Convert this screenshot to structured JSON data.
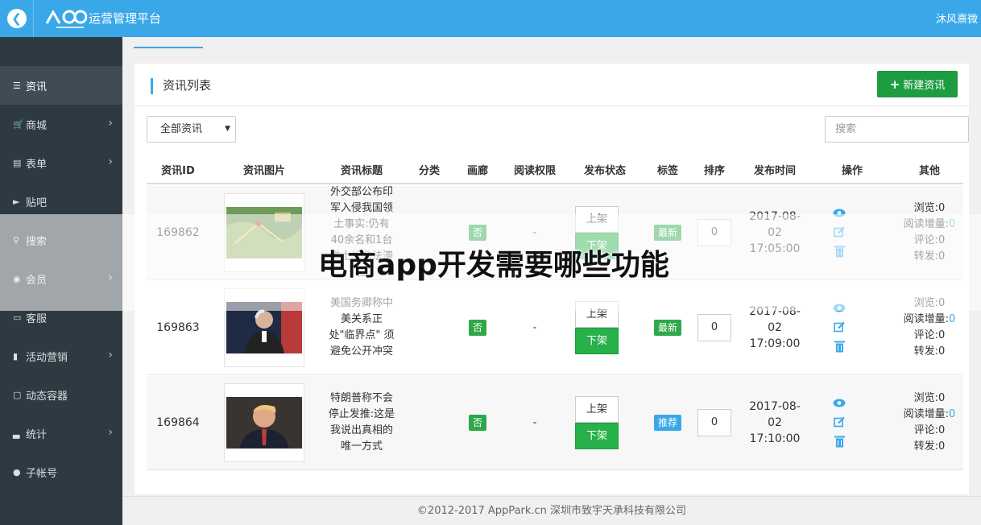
{
  "header": {
    "title": "运营管理平台",
    "user": "沐风熹微"
  },
  "sidebar": {
    "items": [
      {
        "label": "资讯",
        "icon": "list-icon"
      },
      {
        "label": "商城",
        "icon": "cart-icon"
      },
      {
        "label": "表单",
        "icon": "form-icon"
      },
      {
        "label": "贴吧",
        "icon": "megaphone-icon"
      },
      {
        "label": "搜索",
        "icon": "search-icon"
      },
      {
        "label": "会员",
        "icon": "bell-icon"
      },
      {
        "label": "客服",
        "icon": "chat-icon"
      },
      {
        "label": "活动营销",
        "icon": "bookmark-icon"
      },
      {
        "label": "动态容器",
        "icon": "container-icon"
      },
      {
        "label": "统计",
        "icon": "bar-chart-icon"
      },
      {
        "label": "子帐号",
        "icon": "user-icon"
      }
    ]
  },
  "panel": {
    "title": "资讯列表",
    "new_button": "新建资讯",
    "filter_value": "全部资讯",
    "search_placeholder": "搜索"
  },
  "table": {
    "columns": [
      "资讯ID",
      "资讯图片",
      "资讯标题",
      "分类",
      "画廊",
      "阅读权限",
      "发布状态",
      "标签",
      "排序",
      "发布时间",
      "操作",
      "其他"
    ],
    "rows": [
      {
        "id": "169862",
        "title_lines": [
          "外交部公布印",
          "军入侵我国领",
          "土事实:仍有",
          "40余名和1台",
          "推土机非法滞",
          "留"
        ],
        "gallery": "否",
        "permission": "-",
        "publish_up": "上架",
        "publish_down": "下架",
        "tag": "最新",
        "sort": "0",
        "time_lines": [
          "2017-08-",
          "02",
          "17:05:00"
        ],
        "stats": {
          "browse": "浏览:0",
          "read_inc_label": "阅读增量:",
          "read_inc_value": "0",
          "comment": "评论:0",
          "share": "转发:0"
        }
      },
      {
        "id": "169863",
        "title_lines": [
          "美国务卿称中",
          "美关系正",
          "处\"临界点\" 须",
          "避免公开冲突"
        ],
        "gallery": "否",
        "permission": "-",
        "publish_up": "上架",
        "publish_down": "下架",
        "tag": "最新",
        "sort": "0",
        "time_lines": [
          "2017-08-",
          "02",
          "17:09:00"
        ],
        "stats": {
          "browse": "浏览:0",
          "read_inc_label": "阅读增量:",
          "read_inc_value": "0",
          "comment": "评论:0",
          "share": "转发:0"
        }
      },
      {
        "id": "169864",
        "title_lines": [
          "特朗普称不会",
          "停止发推:这是",
          "我说出真相的",
          "唯一方式"
        ],
        "gallery": "否",
        "permission": "-",
        "publish_up": "上架",
        "publish_down": "下架",
        "tag": "推荐",
        "sort": "0",
        "time_lines": [
          "2017-08-",
          "02",
          "17:10:00"
        ],
        "stats": {
          "browse": "浏览:0",
          "read_inc_label": "阅读增量:",
          "read_inc_value": "0",
          "comment": "评论:0",
          "share": "转发:0"
        }
      }
    ]
  },
  "footer": "©2012-2017 AppPark.cn 深圳市致宇天承科技有限公司",
  "watermark": "电商app开发需要哪些功能",
  "colors": {
    "accent": "#3aa8e8",
    "sidebar": "#2e3a42",
    "success": "#1e9c42"
  }
}
